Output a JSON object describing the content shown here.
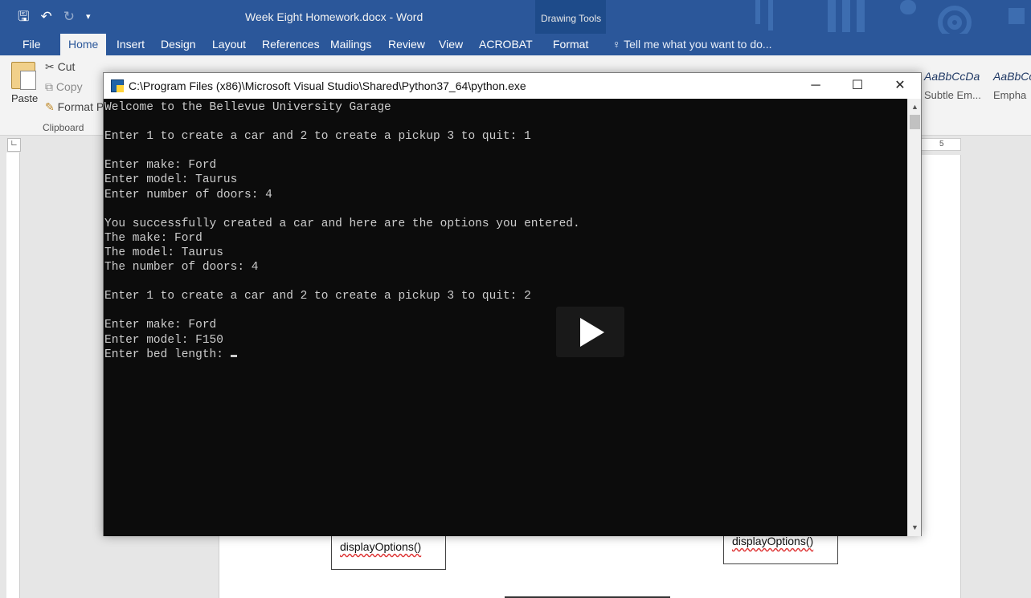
{
  "word": {
    "title": "Week Eight Homework.docx - Word",
    "context_tab_group": "Drawing Tools",
    "tabs": [
      "File",
      "Home",
      "Insert",
      "Design",
      "Layout",
      "References",
      "Mailings",
      "Review",
      "View",
      "ACROBAT",
      "Format"
    ],
    "active_tab": "Home",
    "tell_me": "Tell me what you want to do...",
    "clipboard": {
      "paste": "Paste",
      "cut": "Cut",
      "copy": "Copy",
      "format_painter": "Format P",
      "group": "Clipboard"
    },
    "styles": [
      {
        "sample": "AaBbCcDa",
        "name": "Subtle Em..."
      },
      {
        "sample": "AaBbCc",
        "name": "Empha"
      }
    ],
    "ruler_mark": "5",
    "uml_methods": [
      "displayOptions()",
      "displayOptions()"
    ]
  },
  "console": {
    "title": "C:\\Program Files (x86)\\Microsoft Visual Studio\\Shared\\Python37_64\\python.exe",
    "lines": [
      "Welcome to the Bellevue University Garage",
      "",
      "Enter 1 to create a car and 2 to create a pickup 3 to quit: 1",
      "",
      "Enter make: Ford",
      "Enter model: Taurus",
      "Enter number of doors: 4",
      "",
      "You successfully created a car and here are the options you entered.",
      "The make: Ford",
      "The model: Taurus",
      "The number of doors: 4",
      "",
      "Enter 1 to create a car and 2 to create a pickup 3 to quit: 2",
      "",
      "Enter make: Ford",
      "Enter model: F150",
      "Enter bed length: "
    ]
  }
}
